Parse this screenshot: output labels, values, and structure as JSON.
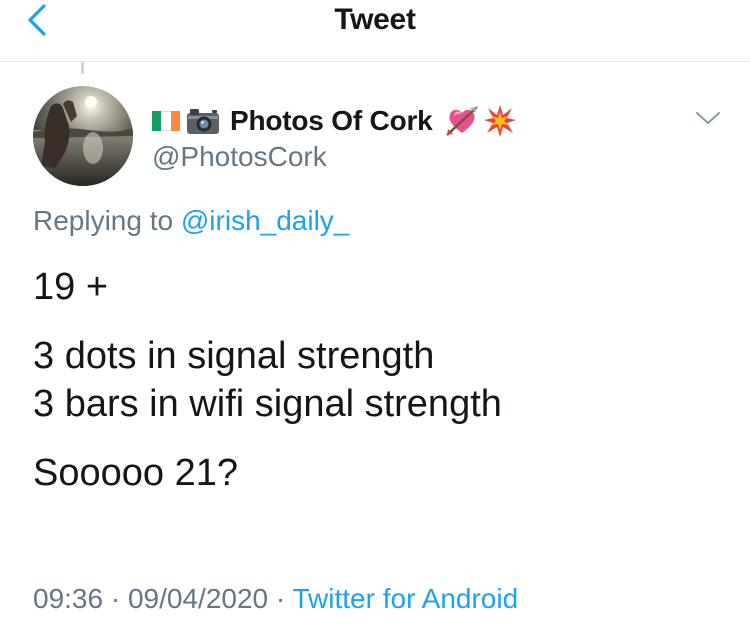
{
  "header": {
    "title": "Tweet",
    "back_icon": "chevron-left-icon",
    "accent": "#1da1f2"
  },
  "author": {
    "display_name": "Photos Of Cork",
    "handle": "@PhotosCork",
    "name_icons_before": [
      "ireland-flag-icon",
      "camera-icon"
    ],
    "name_icons_after": [
      "heart-with-arrow-icon",
      "collision-icon"
    ]
  },
  "reply": {
    "prefix": "Replying to",
    "to": "@irish_daily_"
  },
  "tweet": {
    "line1": "19 +",
    "line2": "3 dots in signal strength",
    "line3": "3 bars in wifi signal strength",
    "line4": "Sooooo 21?"
  },
  "meta": {
    "time": "09:36",
    "sep1": " · ",
    "date": "09/04/2020",
    "sep2": " · ",
    "source": "Twitter for Android"
  },
  "colors": {
    "secondary_text": "#657786",
    "link": "#1da1f2",
    "divider": "#e1e8ed"
  }
}
